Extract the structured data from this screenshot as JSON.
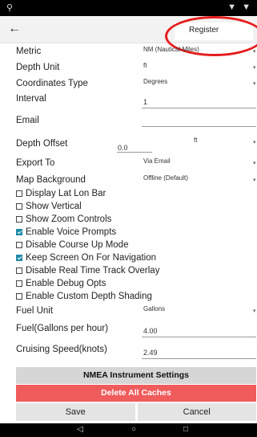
{
  "status_bar": {
    "left_icon": "signal-icon",
    "right_icons": "▼ ▼"
  },
  "app_bar": {
    "back_icon": "back-arrow-icon",
    "back_glyph": "←",
    "register_label": "Register",
    "highlight_color": "#e51d1d"
  },
  "settings": {
    "metric": {
      "label": "Metric",
      "value": "NM (Nautical Miles)"
    },
    "depth_unit": {
      "label": "Depth Unit",
      "value": "ft"
    },
    "coordinates_type": {
      "label": "Coordinates Type",
      "value": "Degrees"
    },
    "interval": {
      "label": "Interval",
      "value": "1"
    },
    "email": {
      "label": "Email",
      "value": ""
    },
    "depth_offset": {
      "label": "Depth Offset",
      "value": "0.0",
      "unit": "ft"
    },
    "export_to": {
      "label": "Export To",
      "value": "Via Email"
    },
    "map_background": {
      "label": "Map Background",
      "value": "Offline (Default)"
    }
  },
  "checkboxes": [
    {
      "label": "Display Lat Lon Bar",
      "checked": false
    },
    {
      "label": "Show Vertical",
      "checked": false
    },
    {
      "label": "Show Zoom Controls",
      "checked": false
    },
    {
      "label": "Enable Voice Prompts",
      "checked": true
    },
    {
      "label": "Disable Course Up Mode",
      "checked": false
    },
    {
      "label": "Keep Screen On For Navigation",
      "checked": true
    },
    {
      "label": "Disable Real Time Track Overlay",
      "checked": false
    },
    {
      "label": "Enable Debug Opts",
      "checked": false
    },
    {
      "label": "Enable Custom Depth Shading",
      "checked": false
    }
  ],
  "fuel": {
    "fuel_unit": {
      "label": "Fuel Unit",
      "value": "Gallons"
    },
    "fuel_rate": {
      "label": "Fuel(Gallons per hour)",
      "value": "4.00"
    },
    "cruising_speed": {
      "label": "Cruising Speed(knots)",
      "value": "2.49"
    }
  },
  "buttons": {
    "nmea": "NMEA Instrument Settings",
    "delete_caches": "Delete All Caches",
    "save": "Save",
    "cancel": "Cancel",
    "accent_color": "#1f8aa7",
    "danger_color": "#f05b5b"
  },
  "nav_bar": {
    "back_glyph": "◁",
    "home_glyph": "○",
    "recents_glyph": "□"
  }
}
